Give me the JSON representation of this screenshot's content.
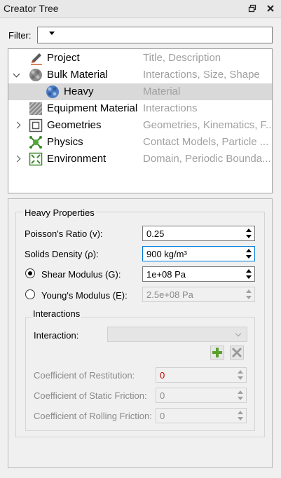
{
  "panel": {
    "title": "Creator Tree",
    "float_icon": "window-restore-icon",
    "close_icon": "close-icon"
  },
  "filter": {
    "label": "Filter:",
    "value": ""
  },
  "tree": {
    "items": [
      {
        "name": "Project",
        "desc": "Title, Description",
        "icon": "pencil-icon",
        "expand": "none",
        "selected": false
      },
      {
        "name": "Bulk Material",
        "desc": "Interactions, Size, Shape",
        "icon": "gray-sphere-icon",
        "expand": "expanded",
        "selected": false
      },
      {
        "name": "Heavy",
        "desc": "Material",
        "icon": "blue-sphere-icon",
        "expand": "none",
        "selected": true,
        "child": true
      },
      {
        "name": "Equipment Material",
        "desc": "Interactions",
        "icon": "hatched-square-icon",
        "expand": "none",
        "selected": false
      },
      {
        "name": "Geometries",
        "desc": "Geometries, Kinematics, F...",
        "icon": "cube-icon",
        "expand": "collapsed",
        "selected": false
      },
      {
        "name": "Physics",
        "desc": "Contact Models, Particle ...",
        "icon": "physics-icon",
        "expand": "none",
        "selected": false
      },
      {
        "name": "Environment",
        "desc": "Domain, Periodic Bounda...",
        "icon": "environment-icon",
        "expand": "collapsed",
        "selected": false
      }
    ]
  },
  "properties": {
    "title": "Heavy Properties",
    "poisson": {
      "label": "Poisson's Ratio (v):",
      "value": "0.25"
    },
    "density": {
      "label": "Solids Density (ρ):",
      "value": "900 kg/m³"
    },
    "shear": {
      "label": "Shear Modulus (G):",
      "value": "1e+08 Pa",
      "selected": true
    },
    "young": {
      "label": "Young's Modulus (E):",
      "value": "2.5e+08 Pa",
      "selected": false
    },
    "interactions": {
      "title": "Interactions",
      "interaction_label": "Interaction:",
      "interaction_value": "",
      "add_icon": "plus-icon",
      "remove_icon": "x-icon",
      "restitution": {
        "label": "Coefficient of Restitution:",
        "value": "0"
      },
      "static_friction": {
        "label": "Coefficient of Static Friction:",
        "value": "0"
      },
      "rolling_friction": {
        "label": "Coefficient of Rolling Friction:",
        "value": "0"
      }
    }
  },
  "colors": {
    "selection": "#d9d9d9",
    "focus_border": "#0078d7",
    "restitution_value": "#c00000",
    "add_green": "#5aa02c"
  }
}
